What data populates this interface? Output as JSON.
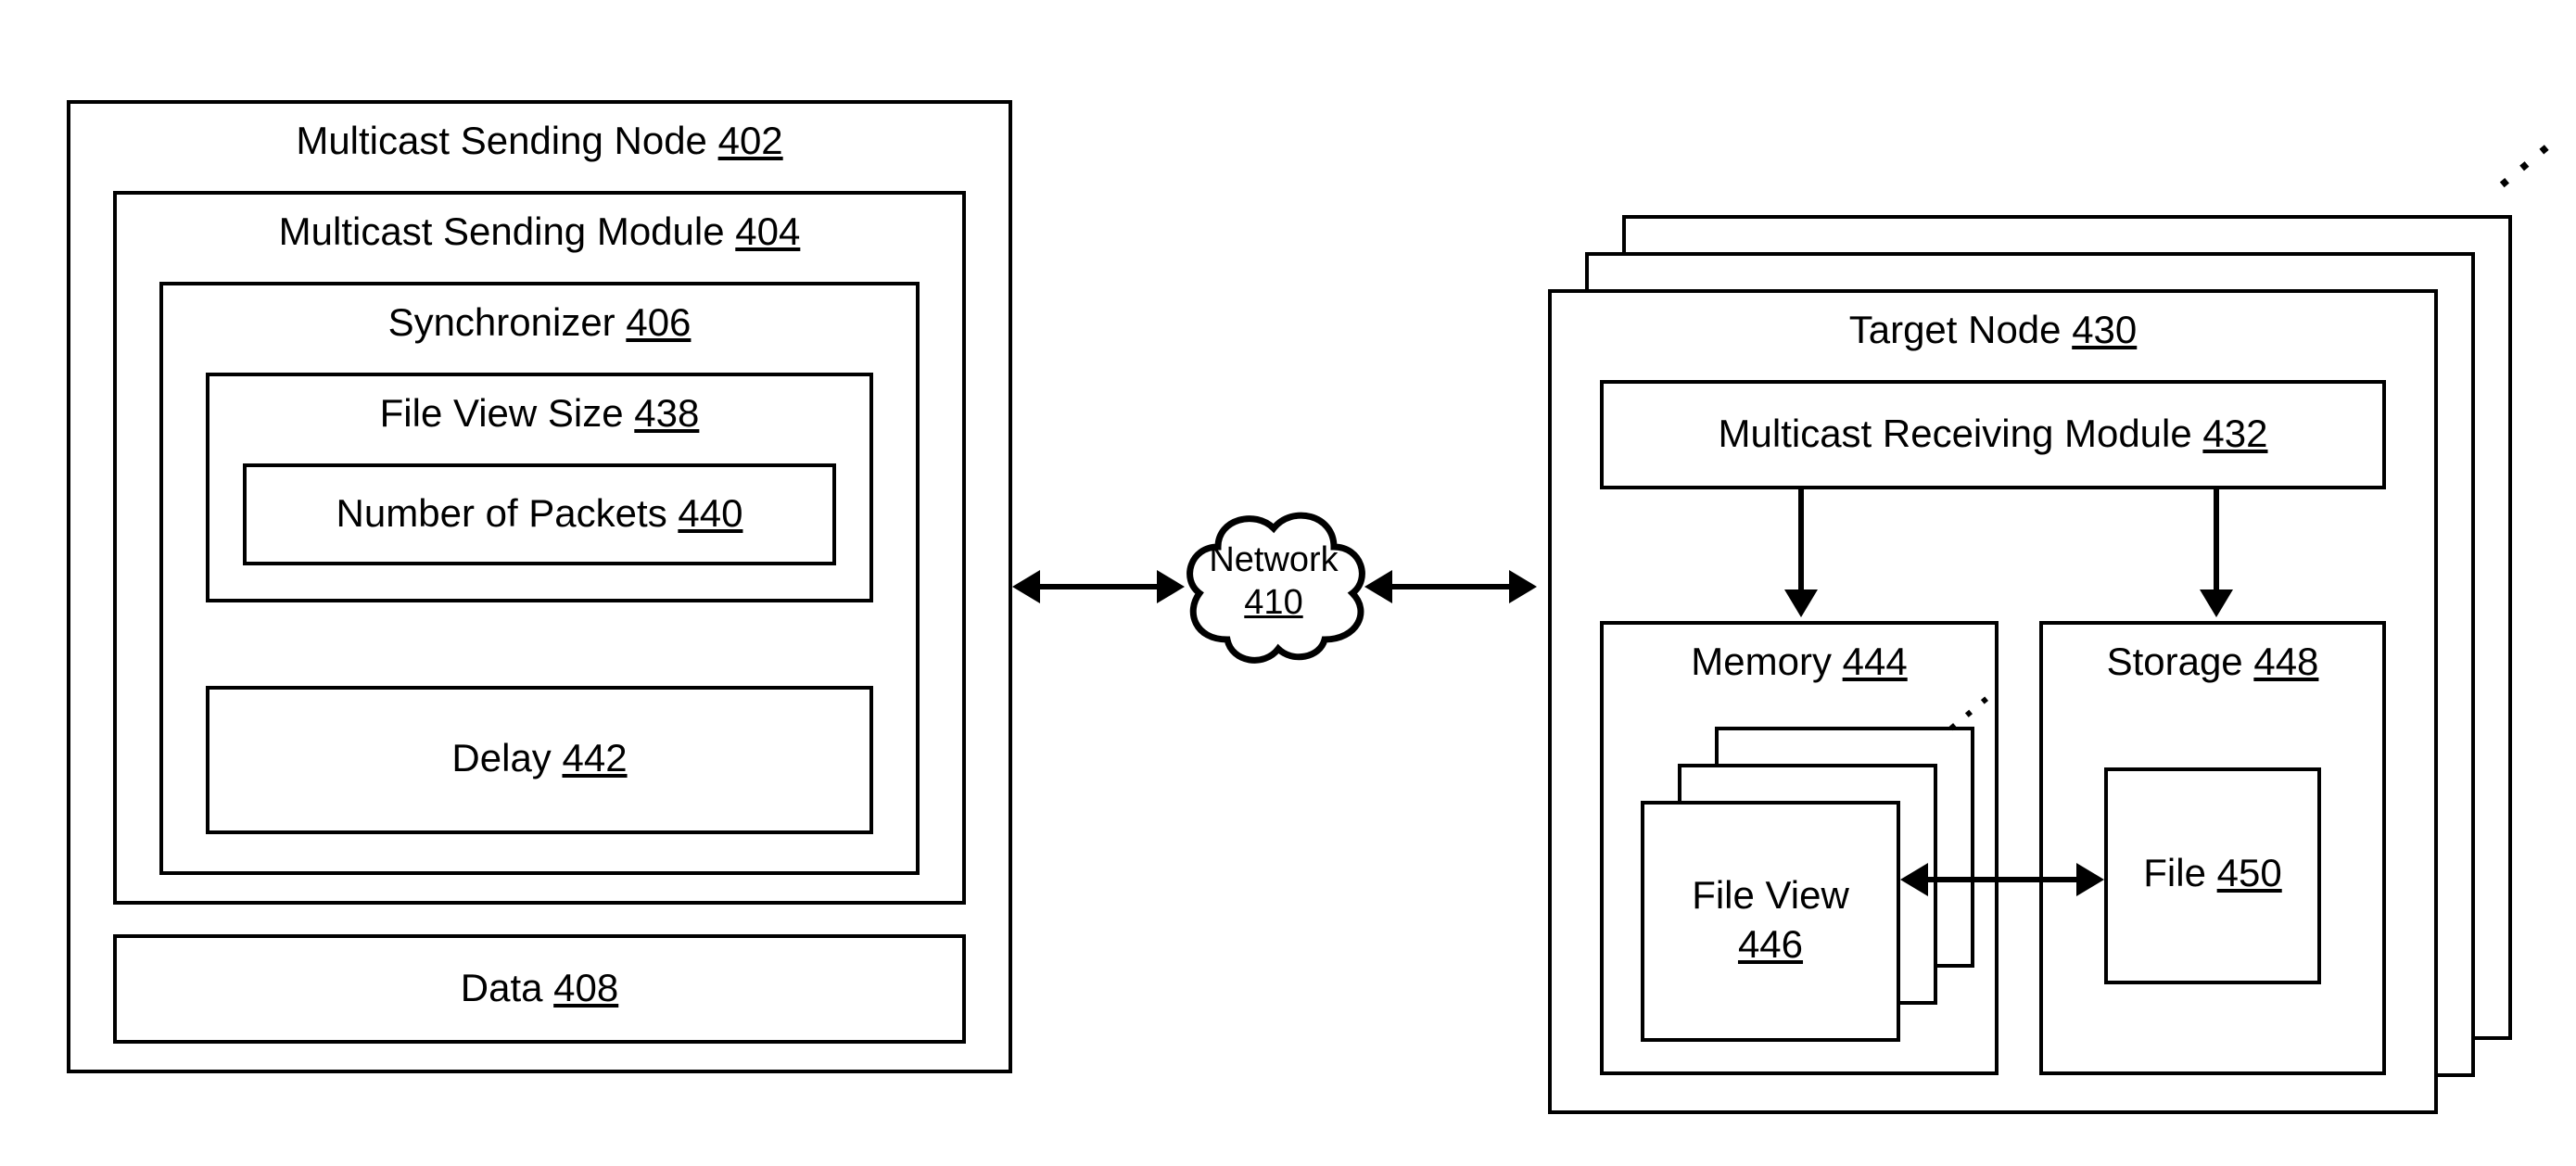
{
  "sender": {
    "node_label": "Multicast Sending Node",
    "node_ref": "402",
    "module_label": "Multicast Sending Module",
    "module_ref": "404",
    "sync_label": "Synchronizer",
    "sync_ref": "406",
    "fvs_label": "File View Size",
    "fvs_ref": "438",
    "nop_label": "Number of Packets",
    "nop_ref": "440",
    "delay_label": "Delay",
    "delay_ref": "442",
    "data_label": "Data",
    "data_ref": "408"
  },
  "network": {
    "label": "Network",
    "ref": "410"
  },
  "target": {
    "node_label": "Target Node",
    "node_ref": "430",
    "module_label": "Multicast Receiving Module",
    "module_ref": "432",
    "memory_label": "Memory",
    "memory_ref": "444",
    "fileview_label": "File View",
    "fileview_ref": "446",
    "storage_label": "Storage",
    "storage_ref": "448",
    "file_label": "File",
    "file_ref": "450"
  }
}
